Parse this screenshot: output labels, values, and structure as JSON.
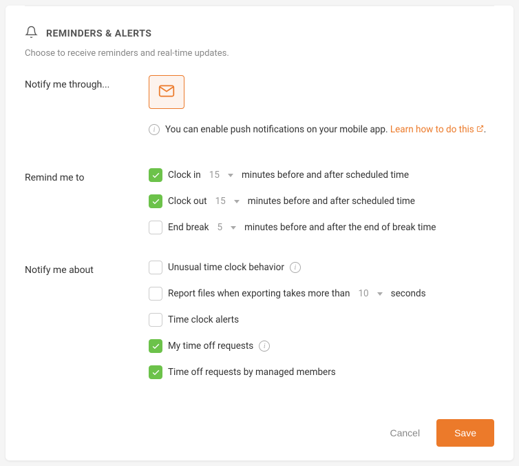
{
  "section": {
    "title": "REMINDERS & ALERTS",
    "subtitle": "Choose to receive reminders and real-time updates."
  },
  "notify_through": {
    "label": "Notify me through..."
  },
  "info": {
    "text": "You can enable push notifications on your mobile app.",
    "link_text": "Learn how to do this"
  },
  "remind": {
    "label": "Remind me to",
    "clock_in_label": "Clock in",
    "clock_in_value": "15",
    "clock_in_suffix": "minutes before and after scheduled time",
    "clock_out_label": "Clock out",
    "clock_out_value": "15",
    "clock_out_suffix": "minutes before and after scheduled time",
    "end_break_label": "End break",
    "end_break_value": "5",
    "end_break_suffix": "minutes before and after the end of break time"
  },
  "notify_about": {
    "label": "Notify me about",
    "unusual_label": "Unusual time clock behavior",
    "report_prefix": "Report files when exporting takes more than",
    "report_value": "10",
    "report_suffix": "seconds",
    "timeclock_alerts_label": "Time clock alerts",
    "my_timeoff_label": "My time off requests",
    "managed_timeoff_label": "Time off requests by managed members"
  },
  "buttons": {
    "cancel": "Cancel",
    "save": "Save"
  },
  "punct": {
    "period": "."
  }
}
